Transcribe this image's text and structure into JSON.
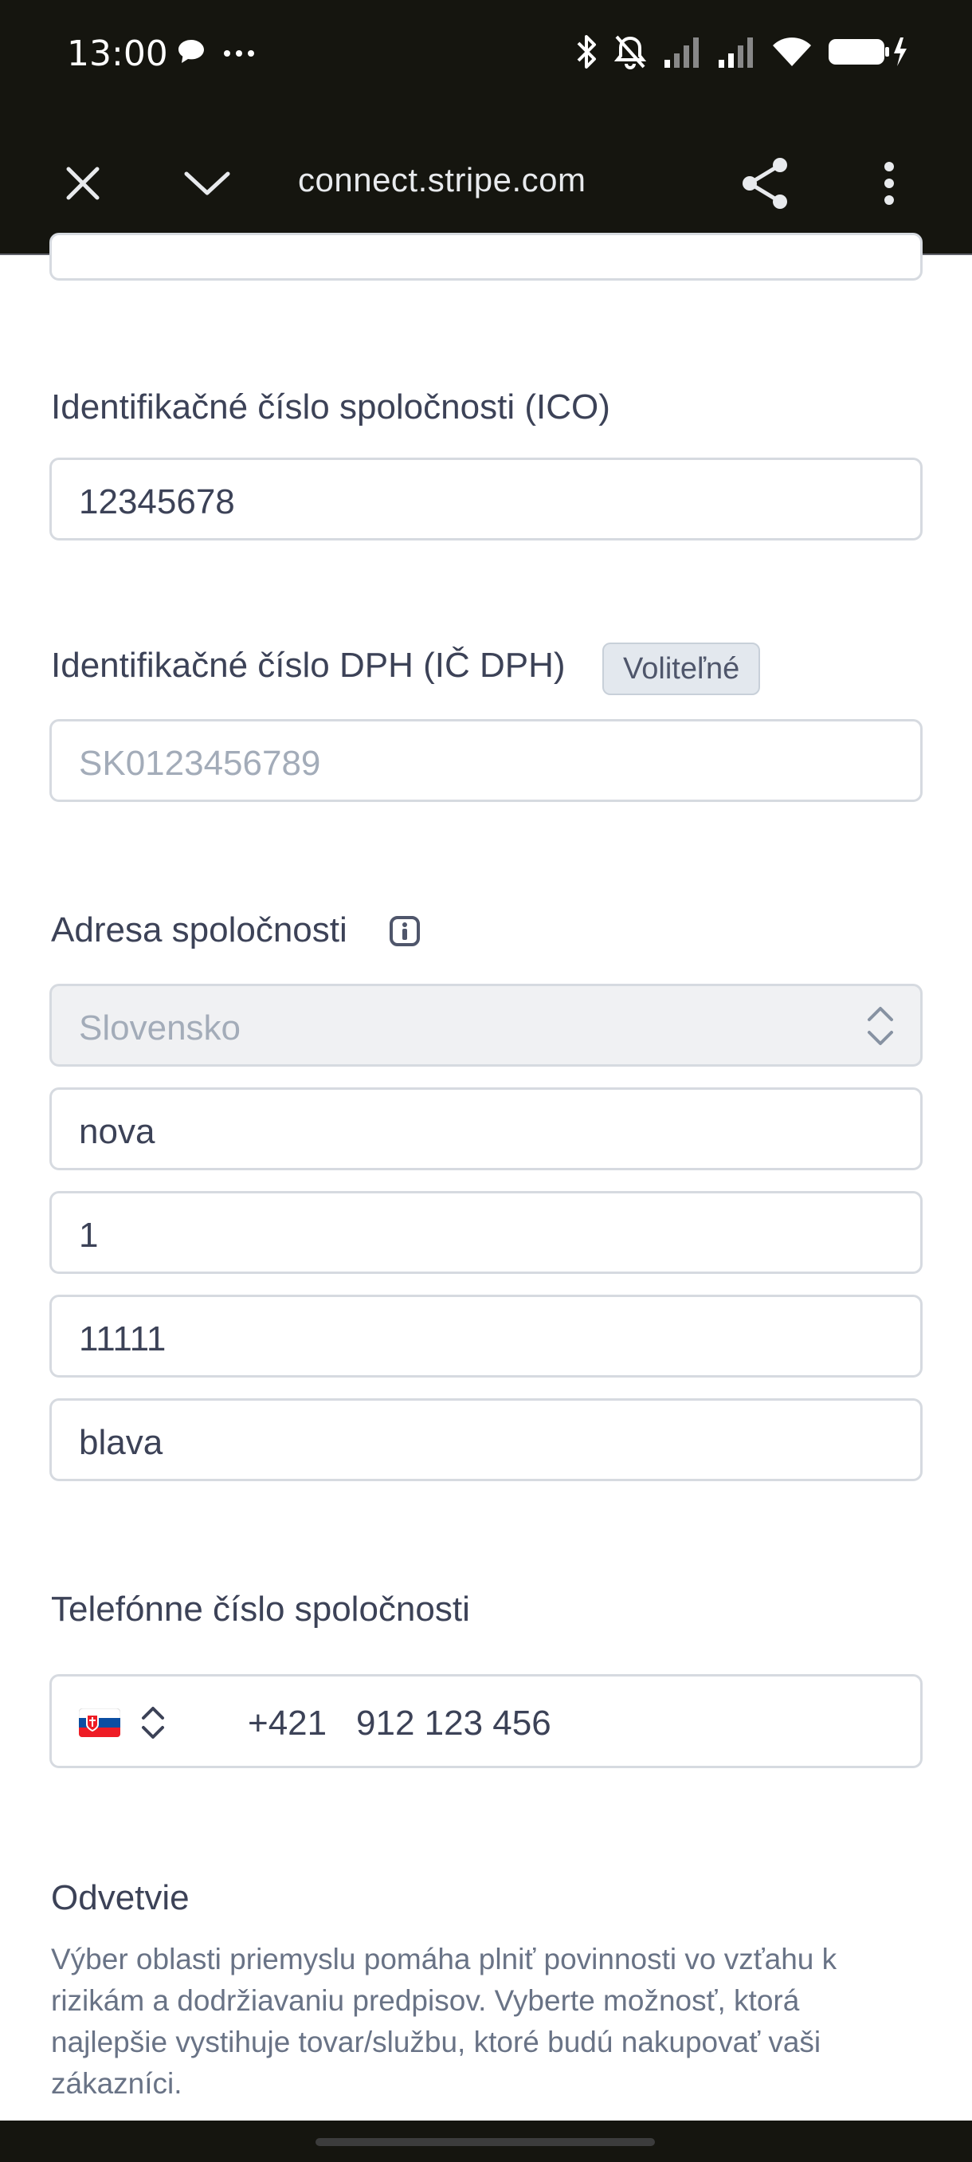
{
  "status_bar": {
    "time": "13:00",
    "left_icons": [
      "chat-bubble-icon",
      "more-dots-icon"
    ],
    "right_icons": [
      "bluetooth-icon",
      "bell-off-icon",
      "signal-icon",
      "signal-icon",
      "wifi-icon",
      "battery-charging-icon"
    ]
  },
  "browser": {
    "url": "connect.stripe.com",
    "icons": [
      "close-icon",
      "chevron-down-icon",
      "share-icon",
      "more-vertical-icon"
    ]
  },
  "form": {
    "ico": {
      "label": "Identifikačné číslo spoločnosti (ICO)",
      "value": "12345678"
    },
    "vat": {
      "label": "Identifikačné číslo DPH (IČ DPH)",
      "badge": "Voliteľné",
      "placeholder": "SK0123456789"
    },
    "address": {
      "label": "Adresa spoločnosti",
      "country": "Slovensko",
      "street": "nova",
      "number": "1",
      "postal_code": "11111",
      "city": "blava"
    },
    "phone": {
      "label": "Telefónne číslo spoločnosti",
      "country_code": "+421",
      "number": "912 123 456"
    },
    "industry": {
      "label": "Odvetvie",
      "helper": "Výber oblasti priemyslu pomáha plniť povinnosti vo vzťahu k rizikám a dodržiavaniu predpisov. Vyberte možnosť, ktorá najlepšie vystihuje tovar/službu, ktoré budú nakupovať vaši zákazníci."
    }
  },
  "colors": {
    "bar_background": "#15150f",
    "input_border": "#d6dae0",
    "text": "#3c4257",
    "placeholder": "#a3acb9"
  }
}
